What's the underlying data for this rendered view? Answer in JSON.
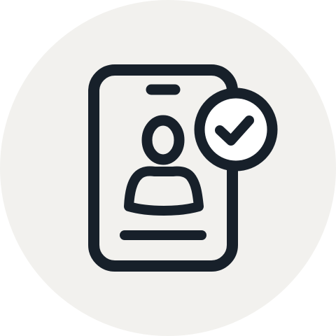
{
  "icon": {
    "name": "verified-user-phone-icon",
    "depicts": [
      "phone-icon",
      "user-icon",
      "checkmark-badge-icon"
    ]
  },
  "colors": {
    "page_background": "#ffffff",
    "circle_background": "#f2f1ee",
    "stroke": "#17202a",
    "badge_fill": "#ffffff"
  }
}
